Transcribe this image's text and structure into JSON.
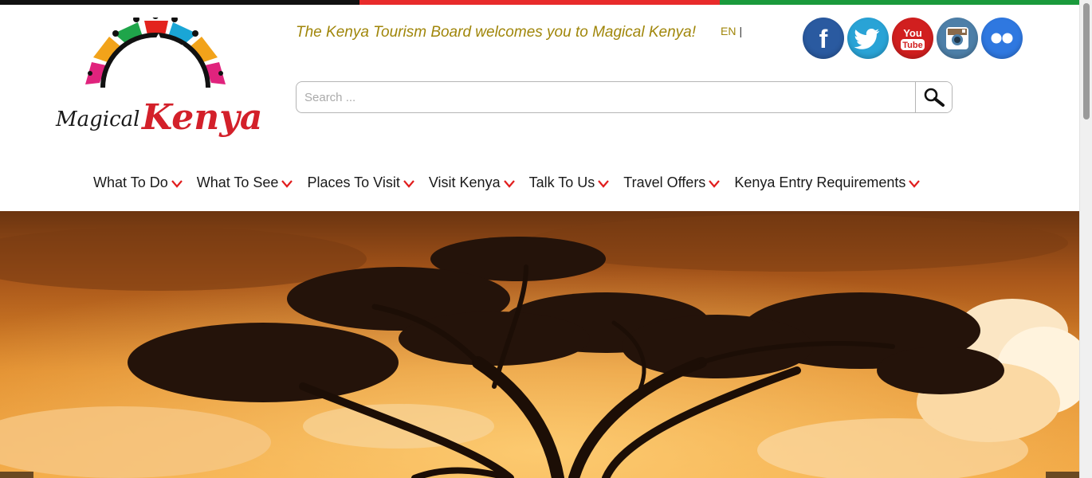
{
  "colors": {
    "stripe": [
      "#111111",
      "#e82b2b",
      "#1a9a3c"
    ],
    "welcome_text": "#a0860a",
    "nav_caret": "#e11d1d",
    "facebook": "#2a5aa0",
    "twitter": "#29a3d6",
    "youtube": "#d11f1f",
    "instagram": "#4d7fa8",
    "flickr": "#2f78e0"
  },
  "logo": {
    "word1": "Magical",
    "word2": "Kenya"
  },
  "header": {
    "welcome": "The Kenya Tourism Board welcomes you to Magical Kenya!",
    "lang": "EN",
    "lang_separator": "|"
  },
  "socials": [
    {
      "name": "facebook",
      "icon": "facebook-icon",
      "glyph": "f"
    },
    {
      "name": "twitter",
      "icon": "twitter-icon"
    },
    {
      "name": "youtube",
      "icon": "youtube-icon",
      "text_top": "You",
      "text_bottom": "Tube"
    },
    {
      "name": "instagram",
      "icon": "instagram-icon"
    },
    {
      "name": "flickr",
      "icon": "flickr-icon"
    }
  ],
  "search": {
    "placeholder": "Search ...",
    "value": "",
    "button_icon": "search-icon"
  },
  "nav": {
    "items": [
      {
        "label": "What To Do"
      },
      {
        "label": "What To See"
      },
      {
        "label": "Places To Visit"
      },
      {
        "label": "Visit Kenya"
      },
      {
        "label": "Talk To Us"
      },
      {
        "label": "Travel Offers"
      },
      {
        "label": "Kenya Entry Requirements"
      }
    ],
    "caret_icon": "chevron-down-icon"
  },
  "hero": {
    "image": "acacia-tree-sunset-image"
  }
}
